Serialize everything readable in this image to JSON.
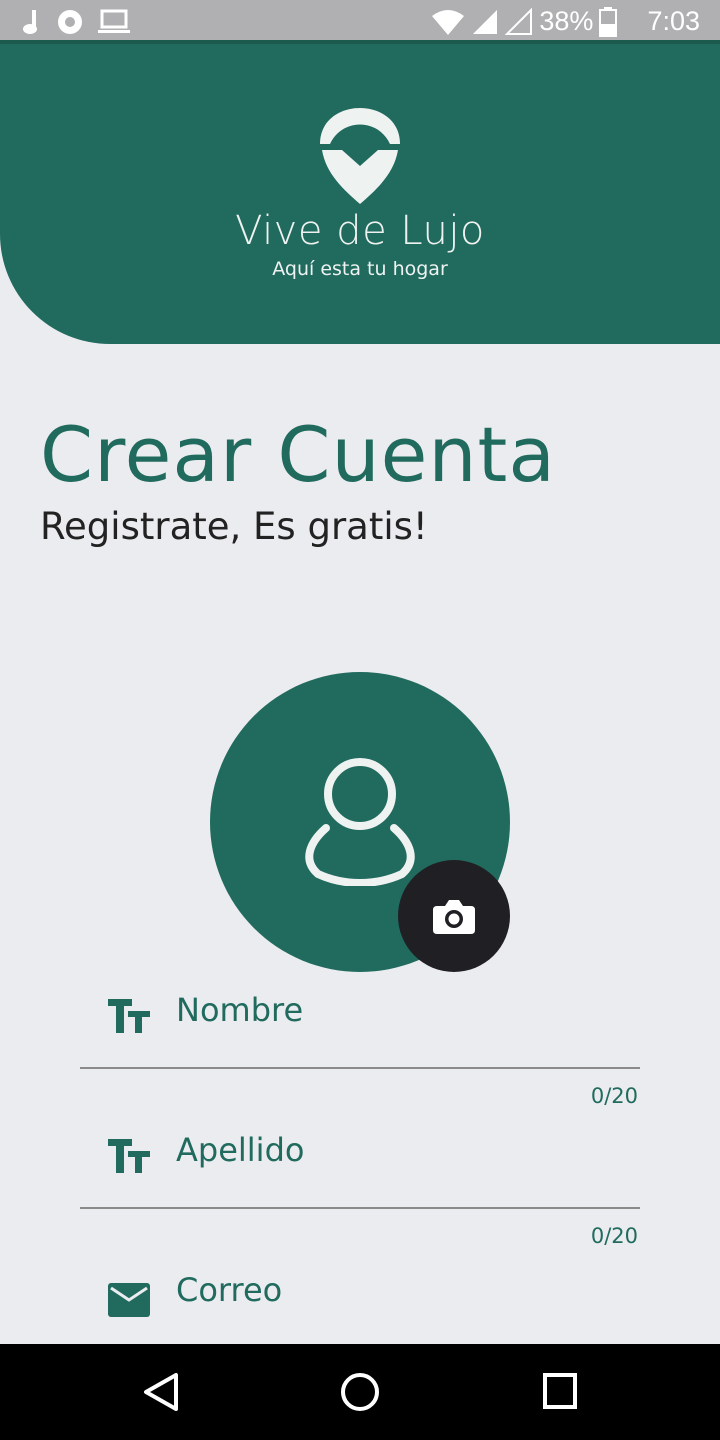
{
  "status_bar": {
    "battery": "38%",
    "time": "7:03",
    "icons": [
      "music-note-icon",
      "record-icon",
      "laptop-icon",
      "wifi-icon",
      "signal-icon",
      "signal-empty-icon",
      "battery-icon"
    ]
  },
  "header": {
    "brand_name": "Vive de Lujo",
    "tagline": "Aquí esta tu hogar",
    "logo": "map-pin-logo"
  },
  "page": {
    "title": "Crear Cuenta",
    "subtitle": "Registrate, Es gratis!"
  },
  "avatar": {
    "icon": "person-icon",
    "action_icon": "camera-icon"
  },
  "form": {
    "fields": [
      {
        "label": "Nombre",
        "icon": "text-size-icon",
        "counter": "0/20"
      },
      {
        "label": "Apellido",
        "icon": "text-size-icon",
        "counter": "0/20"
      },
      {
        "label": "Correo",
        "icon": "email-icon"
      }
    ]
  },
  "nav_bar": {
    "buttons": [
      "back-icon",
      "home-icon",
      "recents-icon"
    ]
  },
  "colors": {
    "primary": "#216b5e",
    "background": "#ebecf0",
    "dark": "#1f1f24"
  }
}
